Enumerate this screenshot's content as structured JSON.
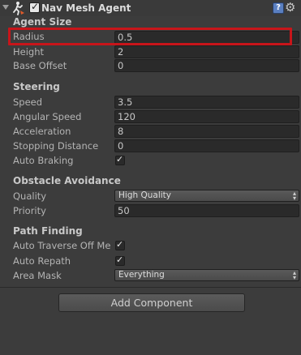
{
  "component": {
    "title": "Nav Mesh Agent",
    "enabled": true,
    "help_icon": "help-icon",
    "settings_icon": "gear-icon"
  },
  "sections": {
    "agent_size": "Agent Size",
    "steering": "Steering",
    "obstacle_avoidance": "Obstacle Avoidance",
    "path_finding": "Path Finding"
  },
  "agent_size": {
    "radius_label": "Radius",
    "radius_value": "0.5",
    "height_label": "Height",
    "height_value": "2",
    "base_offset_label": "Base Offset",
    "base_offset_value": "0"
  },
  "steering": {
    "speed_label": "Speed",
    "speed_value": "3.5",
    "angular_speed_label": "Angular Speed",
    "angular_speed_value": "120",
    "acceleration_label": "Acceleration",
    "acceleration_value": "8",
    "stopping_distance_label": "Stopping Distance",
    "stopping_distance_value": "0",
    "auto_braking_label": "Auto Braking",
    "auto_braking_checked": true
  },
  "obstacle_avoidance": {
    "quality_label": "Quality",
    "quality_value": "High Quality",
    "priority_label": "Priority",
    "priority_value": "50"
  },
  "path_finding": {
    "auto_traverse_label": "Auto Traverse Off Me",
    "auto_traverse_checked": true,
    "auto_repath_label": "Auto Repath",
    "auto_repath_checked": true,
    "area_mask_label": "Area Mask",
    "area_mask_value": "Everything"
  },
  "add_component_label": "Add Component",
  "colors": {
    "highlight": "#c8151a",
    "background": "#3c3c3c",
    "field": "#2a2a2a"
  }
}
